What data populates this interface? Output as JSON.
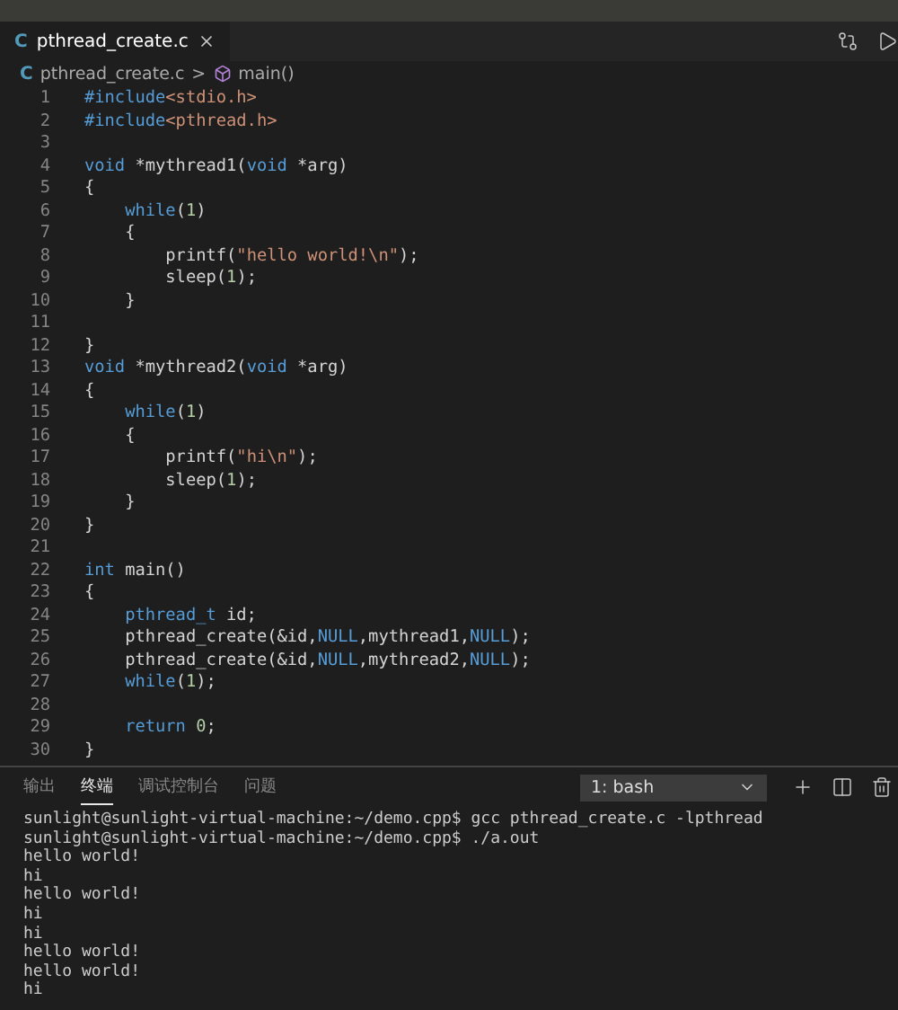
{
  "editor_tabs": [
    {
      "label": "pthread_create.c",
      "icon_text": "C",
      "selected": true
    }
  ],
  "breadcrumb": {
    "icon_text": "C",
    "file": "pthread_create.c",
    "separator": ">",
    "symbol": "main()"
  },
  "code_lines": [
    {
      "number": "1",
      "tokens": [
        {
          "kind": "keyword",
          "text": "#include"
        },
        {
          "kind": "string",
          "text": "<stdio.h>"
        }
      ]
    },
    {
      "number": "2",
      "tokens": [
        {
          "kind": "keyword",
          "text": "#include"
        },
        {
          "kind": "string",
          "text": "<pthread.h>"
        }
      ]
    },
    {
      "number": "3"
    },
    {
      "number": "4",
      "tokens": [
        {
          "kind": "keyword",
          "text": "void"
        },
        {
          "kind": "plain",
          "text": " *mythread1("
        },
        {
          "kind": "keyword",
          "text": "void"
        },
        {
          "kind": "plain",
          "text": " *arg)"
        }
      ]
    },
    {
      "number": "5",
      "tokens": [
        {
          "kind": "plain",
          "text": "{"
        }
      ]
    },
    {
      "number": "6",
      "tokens": [
        {
          "kind": "keyword",
          "text": "    while"
        },
        {
          "kind": "plain",
          "text": "("
        },
        {
          "kind": "number",
          "text": "1"
        },
        {
          "kind": "plain",
          "text": ")"
        }
      ]
    },
    {
      "number": "7",
      "tokens": [
        {
          "kind": "plain",
          "text": "    {"
        }
      ]
    },
    {
      "number": "8",
      "tokens": [
        {
          "kind": "plain",
          "text": "        printf("
        },
        {
          "kind": "string",
          "text": "\"hello world!\\n\""
        },
        {
          "kind": "plain",
          "text": ");"
        }
      ]
    },
    {
      "number": "9",
      "tokens": [
        {
          "kind": "plain",
          "text": "        sleep("
        },
        {
          "kind": "number",
          "text": "1"
        },
        {
          "kind": "plain",
          "text": ");"
        }
      ]
    },
    {
      "number": "10",
      "tokens": [
        {
          "kind": "plain",
          "text": "    }"
        }
      ]
    },
    {
      "number": "11"
    },
    {
      "number": "12",
      "tokens": [
        {
          "kind": "plain",
          "text": "}"
        }
      ]
    },
    {
      "number": "13",
      "tokens": [
        {
          "kind": "keyword",
          "text": "void"
        },
        {
          "kind": "plain",
          "text": " *mythread2("
        },
        {
          "kind": "keyword",
          "text": "void"
        },
        {
          "kind": "plain",
          "text": " *arg)"
        }
      ]
    },
    {
      "number": "14",
      "tokens": [
        {
          "kind": "plain",
          "text": "{"
        }
      ]
    },
    {
      "number": "15",
      "tokens": [
        {
          "kind": "keyword",
          "text": "    while"
        },
        {
          "kind": "plain",
          "text": "("
        },
        {
          "kind": "number",
          "text": "1"
        },
        {
          "kind": "plain",
          "text": ")"
        }
      ]
    },
    {
      "number": "16",
      "tokens": [
        {
          "kind": "plain",
          "text": "    {"
        }
      ]
    },
    {
      "number": "17",
      "tokens": [
        {
          "kind": "plain",
          "text": "        printf("
        },
        {
          "kind": "string",
          "text": "\"hi\\n\""
        },
        {
          "kind": "plain",
          "text": ");"
        }
      ]
    },
    {
      "number": "18",
      "tokens": [
        {
          "kind": "plain",
          "text": "        sleep("
        },
        {
          "kind": "number",
          "text": "1"
        },
        {
          "kind": "plain",
          "text": ");"
        }
      ]
    },
    {
      "number": "19",
      "tokens": [
        {
          "kind": "plain",
          "text": "    }"
        }
      ]
    },
    {
      "number": "20",
      "tokens": [
        {
          "kind": "plain",
          "text": "}"
        }
      ]
    },
    {
      "number": "21"
    },
    {
      "number": "22",
      "tokens": [
        {
          "kind": "keyword",
          "text": "int"
        },
        {
          "kind": "plain",
          "text": " main()"
        }
      ]
    },
    {
      "number": "23",
      "tokens": [
        {
          "kind": "plain",
          "text": "{"
        }
      ]
    },
    {
      "number": "24",
      "tokens": [
        {
          "kind": "keyword",
          "text": "    pthread_t"
        },
        {
          "kind": "plain",
          "text": " id;"
        }
      ]
    },
    {
      "number": "25",
      "tokens": [
        {
          "kind": "plain",
          "text": "    pthread_create(&id,"
        },
        {
          "kind": "keyword",
          "text": "NULL"
        },
        {
          "kind": "plain",
          "text": ",mythread1,"
        },
        {
          "kind": "keyword",
          "text": "NULL"
        },
        {
          "kind": "plain",
          "text": ");"
        }
      ]
    },
    {
      "number": "26",
      "tokens": [
        {
          "kind": "plain",
          "text": "    pthread_create(&id,"
        },
        {
          "kind": "keyword",
          "text": "NULL"
        },
        {
          "kind": "plain",
          "text": ",mythread2,"
        },
        {
          "kind": "keyword",
          "text": "NULL"
        },
        {
          "kind": "plain",
          "text": ");"
        }
      ]
    },
    {
      "number": "27",
      "tokens": [
        {
          "kind": "keyword",
          "text": "    while"
        },
        {
          "kind": "plain",
          "text": "("
        },
        {
          "kind": "number",
          "text": "1"
        },
        {
          "kind": "plain",
          "text": ");"
        }
      ]
    },
    {
      "number": "28"
    },
    {
      "number": "29",
      "tokens": [
        {
          "kind": "keyword",
          "text": "    return"
        },
        {
          "kind": "number",
          "text": " 0"
        },
        {
          "kind": "plain",
          "text": ";"
        }
      ]
    },
    {
      "number": "30",
      "tokens": [
        {
          "kind": "plain",
          "text": "}"
        }
      ]
    }
  ],
  "panel_tabs": [
    {
      "label": "输出",
      "selected": false
    },
    {
      "label": "终端",
      "selected": true
    },
    {
      "label": "调试控制台",
      "selected": false
    },
    {
      "label": "问题",
      "selected": false
    }
  ],
  "terminal_select": {
    "value": "1: bash"
  },
  "terminal_lines": [
    "sunlight@sunlight-virtual-machine:~/demo.cpp$ gcc pthread_create.c -lpthread",
    "sunlight@sunlight-virtual-machine:~/demo.cpp$ ./a.out",
    "hello world!",
    "hi",
    "hello world!",
    "hi",
    "hi",
    "hello world!",
    "hello world!",
    "hi"
  ]
}
